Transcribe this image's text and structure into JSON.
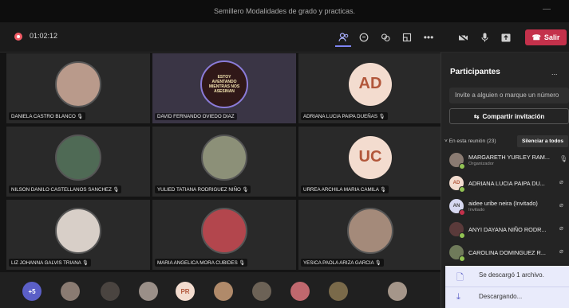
{
  "window": {
    "title": "Semillero Modalidades de grado y practicas."
  },
  "toolbar": {
    "timer": "01:02:12",
    "leave_label": "Salir"
  },
  "tiles": [
    {
      "name": "DANIELA CASTRO BLANCO",
      "type": "photo",
      "color": "#b99a8b"
    },
    {
      "name": "DAVID FERNANDO OVIEDO DIAZ",
      "type": "poster",
      "poster_text": "ESTOY AVENTANDO MIENTRAS NOS ASESINAN",
      "color": "#5a2a2a"
    },
    {
      "name": "ADRIANA LUCIA PAIPA DUEÑAS",
      "type": "initials",
      "initials": "AD"
    },
    {
      "name": "NILSON DANILO CASTELLANOS SANCHEZ",
      "type": "photo",
      "color": "#4f6a55"
    },
    {
      "name": "YULIED TATIANA RODRIGUEZ NIÑO",
      "type": "photo",
      "color": "#8c9078"
    },
    {
      "name": "URREA ARCHILA MARIA CAMILA",
      "type": "initials",
      "initials": "UC"
    },
    {
      "name": "LIZ JOHANNA GALVIS TRIANA",
      "type": "photo",
      "color": "#d8cfc8"
    },
    {
      "name": "MARIA ANGELICA MORA CUBIDES",
      "type": "photo",
      "color": "#b3464d"
    },
    {
      "name": "YESICA PAOLA ARIZA GARCIA",
      "type": "photo",
      "color": "#a48a7a"
    }
  ],
  "strip": {
    "overflow": "+5",
    "pr_initials": "PR"
  },
  "panel": {
    "title": "Participantes",
    "more": "...",
    "invite_placeholder": "Invite a alguien o marque un número",
    "share_label": "Compartir invitación",
    "in_meeting": "En esta reunión (23)",
    "mute_all": "Silenciar a todos",
    "participants": [
      {
        "name": "MARGARETH YURLEY RAM...",
        "role": "Organizador",
        "avatar": "photo",
        "status": "on"
      },
      {
        "name": "ADRIANA LUCIA PAIPA DU...",
        "role": "",
        "avatar": "AD",
        "status": "on"
      },
      {
        "name": "aidee uribe neira (Invitado)",
        "role": "Invitado",
        "avatar": "AN",
        "status": "off"
      },
      {
        "name": "ANYI DAYANA NIÑO RODR...",
        "role": "",
        "avatar": "photo",
        "status": "on"
      },
      {
        "name": "CAROLINA DOMINGUEZ R...",
        "role": "",
        "avatar": "photo",
        "status": "on"
      }
    ]
  },
  "toast": {
    "downloaded": "Se descargó 1 archivo.",
    "downloading": "Descargando..."
  }
}
